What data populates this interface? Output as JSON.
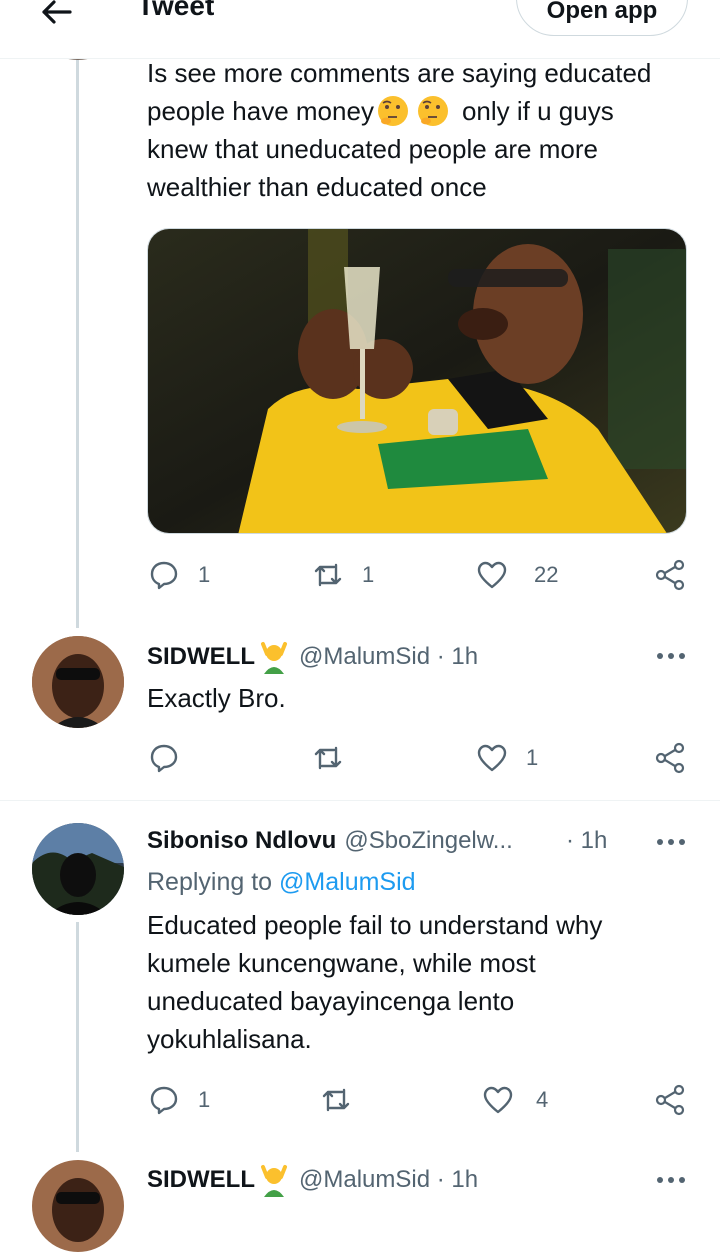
{
  "header": {
    "title": "Tweet",
    "open_app": "Open app"
  },
  "main_tweet": {
    "text_line1": "Is see more comments are saying educated",
    "text_line2a": "people have money",
    "text_line2b": "only if u guys",
    "text_line3": "knew that uneducated people are more",
    "text_line4": "wealthier than educated once",
    "replies": "1",
    "retweets": "1",
    "likes": "22"
  },
  "reply1": {
    "name": "SIDWELL",
    "handle": "@MalumSid · 1h",
    "text": "Exactly Bro.",
    "replies": "",
    "retweets": "",
    "likes": "1"
  },
  "reply2": {
    "name": "Siboniso Ndlovu",
    "handle": "@SboZingelw...",
    "time": "· 1h",
    "replying_prefix": "Replying to",
    "replying_mention": "@MalumSid",
    "text_line1": "Educated people fail to understand why",
    "text_line2": "kumele kuncengwane, while most",
    "text_line3": "uneducated bayayincenga lento",
    "text_line4": "yokuhlalisana.",
    "replies": "1",
    "retweets": "",
    "likes": "4"
  },
  "reply3": {
    "name": "SIDWELL",
    "handle": "@MalumSid · 1h"
  },
  "colors": {
    "text": "#0f1419",
    "muted": "#536471",
    "link": "#1d9bf0",
    "border": "#cfd9de"
  },
  "icons": [
    "back-arrow-icon",
    "reply-icon",
    "retweet-icon",
    "like-icon",
    "share-icon",
    "more-icon",
    "thinking-face-emoji",
    "person-gesturing-emoji"
  ]
}
